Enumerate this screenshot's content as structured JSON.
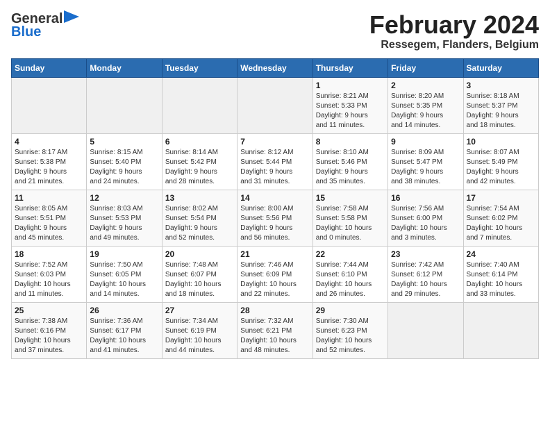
{
  "header": {
    "logo": {
      "line1": "General",
      "line2": "Blue"
    },
    "title": "February 2024",
    "subtitle": "Ressegem, Flanders, Belgium"
  },
  "calendar": {
    "days_of_week": [
      "Sunday",
      "Monday",
      "Tuesday",
      "Wednesday",
      "Thursday",
      "Friday",
      "Saturday"
    ],
    "weeks": [
      [
        {
          "day": "",
          "info": ""
        },
        {
          "day": "",
          "info": ""
        },
        {
          "day": "",
          "info": ""
        },
        {
          "day": "",
          "info": ""
        },
        {
          "day": "1",
          "info": "Sunrise: 8:21 AM\nSunset: 5:33 PM\nDaylight: 9 hours\nand 11 minutes."
        },
        {
          "day": "2",
          "info": "Sunrise: 8:20 AM\nSunset: 5:35 PM\nDaylight: 9 hours\nand 14 minutes."
        },
        {
          "day": "3",
          "info": "Sunrise: 8:18 AM\nSunset: 5:37 PM\nDaylight: 9 hours\nand 18 minutes."
        }
      ],
      [
        {
          "day": "4",
          "info": "Sunrise: 8:17 AM\nSunset: 5:38 PM\nDaylight: 9 hours\nand 21 minutes."
        },
        {
          "day": "5",
          "info": "Sunrise: 8:15 AM\nSunset: 5:40 PM\nDaylight: 9 hours\nand 24 minutes."
        },
        {
          "day": "6",
          "info": "Sunrise: 8:14 AM\nSunset: 5:42 PM\nDaylight: 9 hours\nand 28 minutes."
        },
        {
          "day": "7",
          "info": "Sunrise: 8:12 AM\nSunset: 5:44 PM\nDaylight: 9 hours\nand 31 minutes."
        },
        {
          "day": "8",
          "info": "Sunrise: 8:10 AM\nSunset: 5:46 PM\nDaylight: 9 hours\nand 35 minutes."
        },
        {
          "day": "9",
          "info": "Sunrise: 8:09 AM\nSunset: 5:47 PM\nDaylight: 9 hours\nand 38 minutes."
        },
        {
          "day": "10",
          "info": "Sunrise: 8:07 AM\nSunset: 5:49 PM\nDaylight: 9 hours\nand 42 minutes."
        }
      ],
      [
        {
          "day": "11",
          "info": "Sunrise: 8:05 AM\nSunset: 5:51 PM\nDaylight: 9 hours\nand 45 minutes."
        },
        {
          "day": "12",
          "info": "Sunrise: 8:03 AM\nSunset: 5:53 PM\nDaylight: 9 hours\nand 49 minutes."
        },
        {
          "day": "13",
          "info": "Sunrise: 8:02 AM\nSunset: 5:54 PM\nDaylight: 9 hours\nand 52 minutes."
        },
        {
          "day": "14",
          "info": "Sunrise: 8:00 AM\nSunset: 5:56 PM\nDaylight: 9 hours\nand 56 minutes."
        },
        {
          "day": "15",
          "info": "Sunrise: 7:58 AM\nSunset: 5:58 PM\nDaylight: 10 hours\nand 0 minutes."
        },
        {
          "day": "16",
          "info": "Sunrise: 7:56 AM\nSunset: 6:00 PM\nDaylight: 10 hours\nand 3 minutes."
        },
        {
          "day": "17",
          "info": "Sunrise: 7:54 AM\nSunset: 6:02 PM\nDaylight: 10 hours\nand 7 minutes."
        }
      ],
      [
        {
          "day": "18",
          "info": "Sunrise: 7:52 AM\nSunset: 6:03 PM\nDaylight: 10 hours\nand 11 minutes."
        },
        {
          "day": "19",
          "info": "Sunrise: 7:50 AM\nSunset: 6:05 PM\nDaylight: 10 hours\nand 14 minutes."
        },
        {
          "day": "20",
          "info": "Sunrise: 7:48 AM\nSunset: 6:07 PM\nDaylight: 10 hours\nand 18 minutes."
        },
        {
          "day": "21",
          "info": "Sunrise: 7:46 AM\nSunset: 6:09 PM\nDaylight: 10 hours\nand 22 minutes."
        },
        {
          "day": "22",
          "info": "Sunrise: 7:44 AM\nSunset: 6:10 PM\nDaylight: 10 hours\nand 26 minutes."
        },
        {
          "day": "23",
          "info": "Sunrise: 7:42 AM\nSunset: 6:12 PM\nDaylight: 10 hours\nand 29 minutes."
        },
        {
          "day": "24",
          "info": "Sunrise: 7:40 AM\nSunset: 6:14 PM\nDaylight: 10 hours\nand 33 minutes."
        }
      ],
      [
        {
          "day": "25",
          "info": "Sunrise: 7:38 AM\nSunset: 6:16 PM\nDaylight: 10 hours\nand 37 minutes."
        },
        {
          "day": "26",
          "info": "Sunrise: 7:36 AM\nSunset: 6:17 PM\nDaylight: 10 hours\nand 41 minutes."
        },
        {
          "day": "27",
          "info": "Sunrise: 7:34 AM\nSunset: 6:19 PM\nDaylight: 10 hours\nand 44 minutes."
        },
        {
          "day": "28",
          "info": "Sunrise: 7:32 AM\nSunset: 6:21 PM\nDaylight: 10 hours\nand 48 minutes."
        },
        {
          "day": "29",
          "info": "Sunrise: 7:30 AM\nSunset: 6:23 PM\nDaylight: 10 hours\nand 52 minutes."
        },
        {
          "day": "",
          "info": ""
        },
        {
          "day": "",
          "info": ""
        }
      ]
    ]
  }
}
